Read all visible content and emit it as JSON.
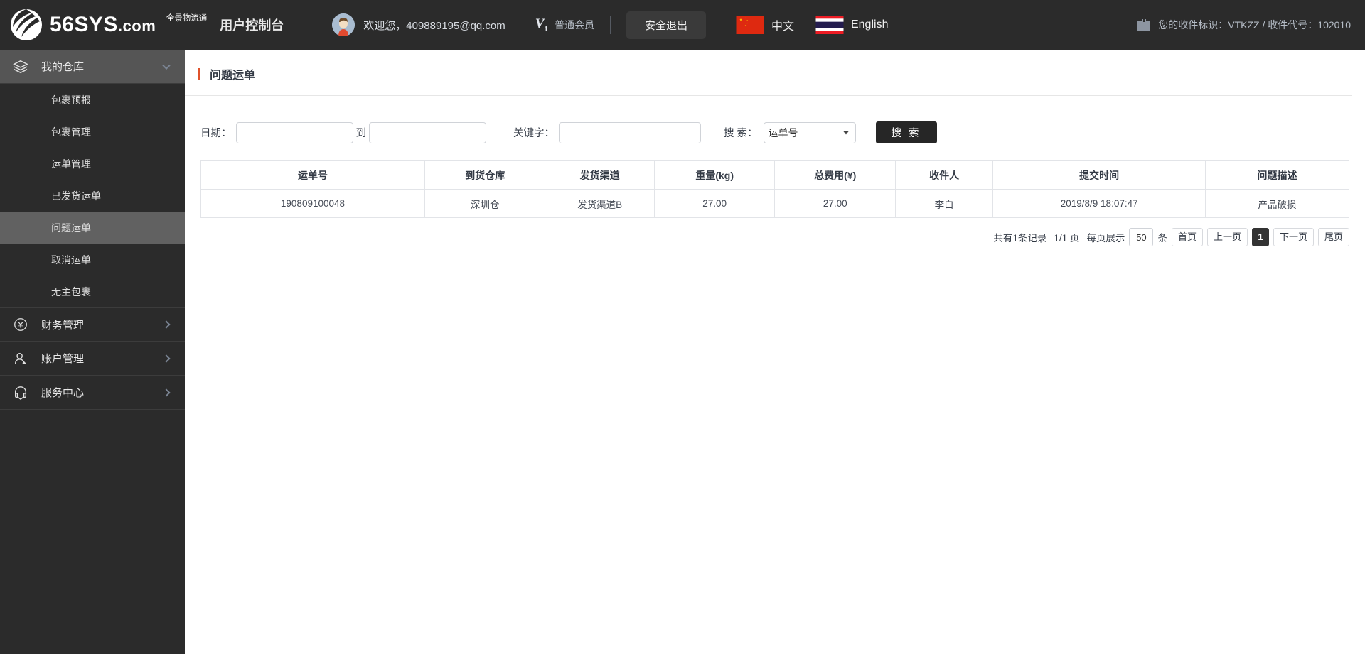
{
  "header": {
    "logo_text": "56SYS",
    "logo_dotcom": ".com",
    "logo_sup": "全景物流通",
    "console_title": "用户控制台",
    "welcome": "欢迎您，409889195@qq.com",
    "vip_badge": "V",
    "vip_level": "1",
    "vip_label": "普通会员",
    "logout_label": "安全退出",
    "lang_cn": "中文",
    "lang_en": "English",
    "recv_info": "您的收件标识：VTKZZ / 收件代号：102010"
  },
  "sidebar": {
    "groups": [
      {
        "label": "我的仓库",
        "icon": "layers-icon",
        "expanded": true,
        "items": [
          {
            "label": "包裹预报",
            "active": false
          },
          {
            "label": "包裹管理",
            "active": false
          },
          {
            "label": "运单管理",
            "active": false
          },
          {
            "label": "已发货运单",
            "active": false
          },
          {
            "label": "问题运单",
            "active": true
          },
          {
            "label": "取消运单",
            "active": false
          },
          {
            "label": "无主包裹",
            "active": false
          }
        ]
      },
      {
        "label": "财务管理",
        "icon": "yen-circle-icon",
        "expanded": false,
        "items": []
      },
      {
        "label": "账户管理",
        "icon": "user-icon",
        "expanded": false,
        "items": []
      },
      {
        "label": "服务中心",
        "icon": "headset-icon",
        "expanded": false,
        "items": []
      }
    ]
  },
  "page": {
    "title": "问题运单"
  },
  "filters": {
    "date_label": "日期：",
    "date_from_value": "",
    "date_to_value": "",
    "between_label": "到",
    "keyword_label": "关键字：",
    "keyword_value": "",
    "search_by_label": "搜 索：",
    "search_by_value": "运单号",
    "search_by_options": [
      "运单号"
    ],
    "search_button": "搜 索"
  },
  "table": {
    "columns": [
      "运单号",
      "到货仓库",
      "发货渠道",
      "重量(kg)",
      "总费用(¥)",
      "收件人",
      "提交时间",
      "问题描述"
    ],
    "rows": [
      {
        "waybill": "190809100048",
        "warehouse": "深圳仓",
        "channel": "发货渠道B",
        "weight": "27.00",
        "fee": "27.00",
        "receiver": "李白",
        "submit_time": "2019/8/9 18:07:47",
        "issue": "产品破损"
      }
    ]
  },
  "pagination": {
    "total_text": "共有1条记录",
    "page_text": "1/1 页",
    "per_page_label": "每页展示",
    "per_page_value": "50",
    "per_page_unit": "条",
    "first": "首页",
    "prev": "上一页",
    "current": "1",
    "next": "下一页",
    "last": "尾页"
  },
  "colors": {
    "header_bg": "#2b2b2b",
    "sidebar_bg": "#2b2b2b",
    "accent": "#e0522b",
    "link": "#3b8fd4",
    "danger": "#e8231b",
    "active_item": "#616161"
  }
}
